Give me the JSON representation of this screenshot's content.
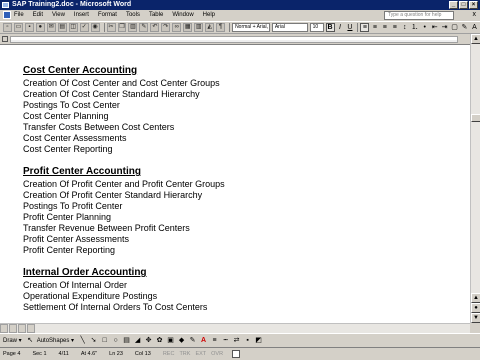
{
  "window": {
    "title": "SAP Training2.doc - Microsoft Word"
  },
  "menubar": {
    "items": [
      "File",
      "Edit",
      "View",
      "Insert",
      "Format",
      "Tools",
      "Table",
      "Window",
      "Help"
    ],
    "help_placeholder": "Type a question for help",
    "close_glyph": "x"
  },
  "toolbar": {
    "style_value": "Normal + Arial,",
    "font_value": "Arial",
    "size_value": "10",
    "bold_glyph": "B",
    "italic_glyph": "I",
    "underline_glyph": "U"
  },
  "document": {
    "sections": [
      {
        "heading": "Cost Center Accounting",
        "lines": [
          "Creation Of Cost Center and Cost Center Groups",
          "Creation Of Cost Center Standard Hierarchy",
          "Postings To Cost Center",
          "Cost Center Planning",
          "Transfer Costs Between Cost Centers",
          "Cost Center Assessments",
          "Cost Center Reporting"
        ]
      },
      {
        "heading": "Profit Center Accounting",
        "lines": [
          "Creation Of Profit Center and Profit Center Groups",
          "Creation Of Profit Center Standard Hierarchy",
          "Postings To Profit Center",
          "Profit Center Planning",
          "Transfer Revenue Between Profit Centers",
          "Profit Center Assessments",
          "Profit Center Reporting"
        ]
      },
      {
        "heading": "Internal Order Accounting",
        "lines": [
          "Creation Of Internal Order",
          "Operational Expenditure Postings",
          "Settlement Of Internal Orders To Cost Centers"
        ]
      }
    ]
  },
  "drawbar": {
    "draw_label": "Draw ▾",
    "autoshapes_label": "AutoShapes ▾"
  },
  "status": {
    "page": "Page 4",
    "section": "Sec 1",
    "pages": "4/11",
    "at": "At 4.6\"",
    "ln": "Ln 23",
    "col": "Col 13",
    "rec": "REC",
    "trk": "TRK",
    "ext": "EXT",
    "ovr": "OVR"
  }
}
